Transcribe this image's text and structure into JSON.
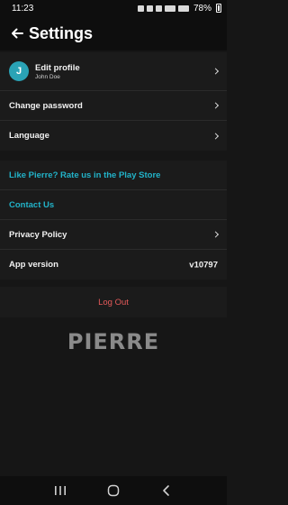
{
  "status_bar": {
    "time": "11:23",
    "battery": "78%"
  },
  "header": {
    "title": "Settings",
    "back_icon": "arrow-left-icon"
  },
  "account": {
    "profile": {
      "title": "Edit profile",
      "name": "John Doe",
      "avatar_initial": "J",
      "avatar_color": "#2aa3b6"
    },
    "change_password": "Change password",
    "language": "Language"
  },
  "about": {
    "rate_us": "Like Pierre? Rate us in the Play Store",
    "contact_us": "Contact Us",
    "privacy_policy": "Privacy Policy",
    "app_version_label": "App version",
    "app_version_value": "v10797"
  },
  "logout": {
    "label": "Log Out",
    "color": "#e55a5a"
  },
  "logo": {
    "text": "PIERRE"
  },
  "colors": {
    "accent": "#22b3c9",
    "background": "#161616",
    "surface": "#1b1b1b"
  }
}
